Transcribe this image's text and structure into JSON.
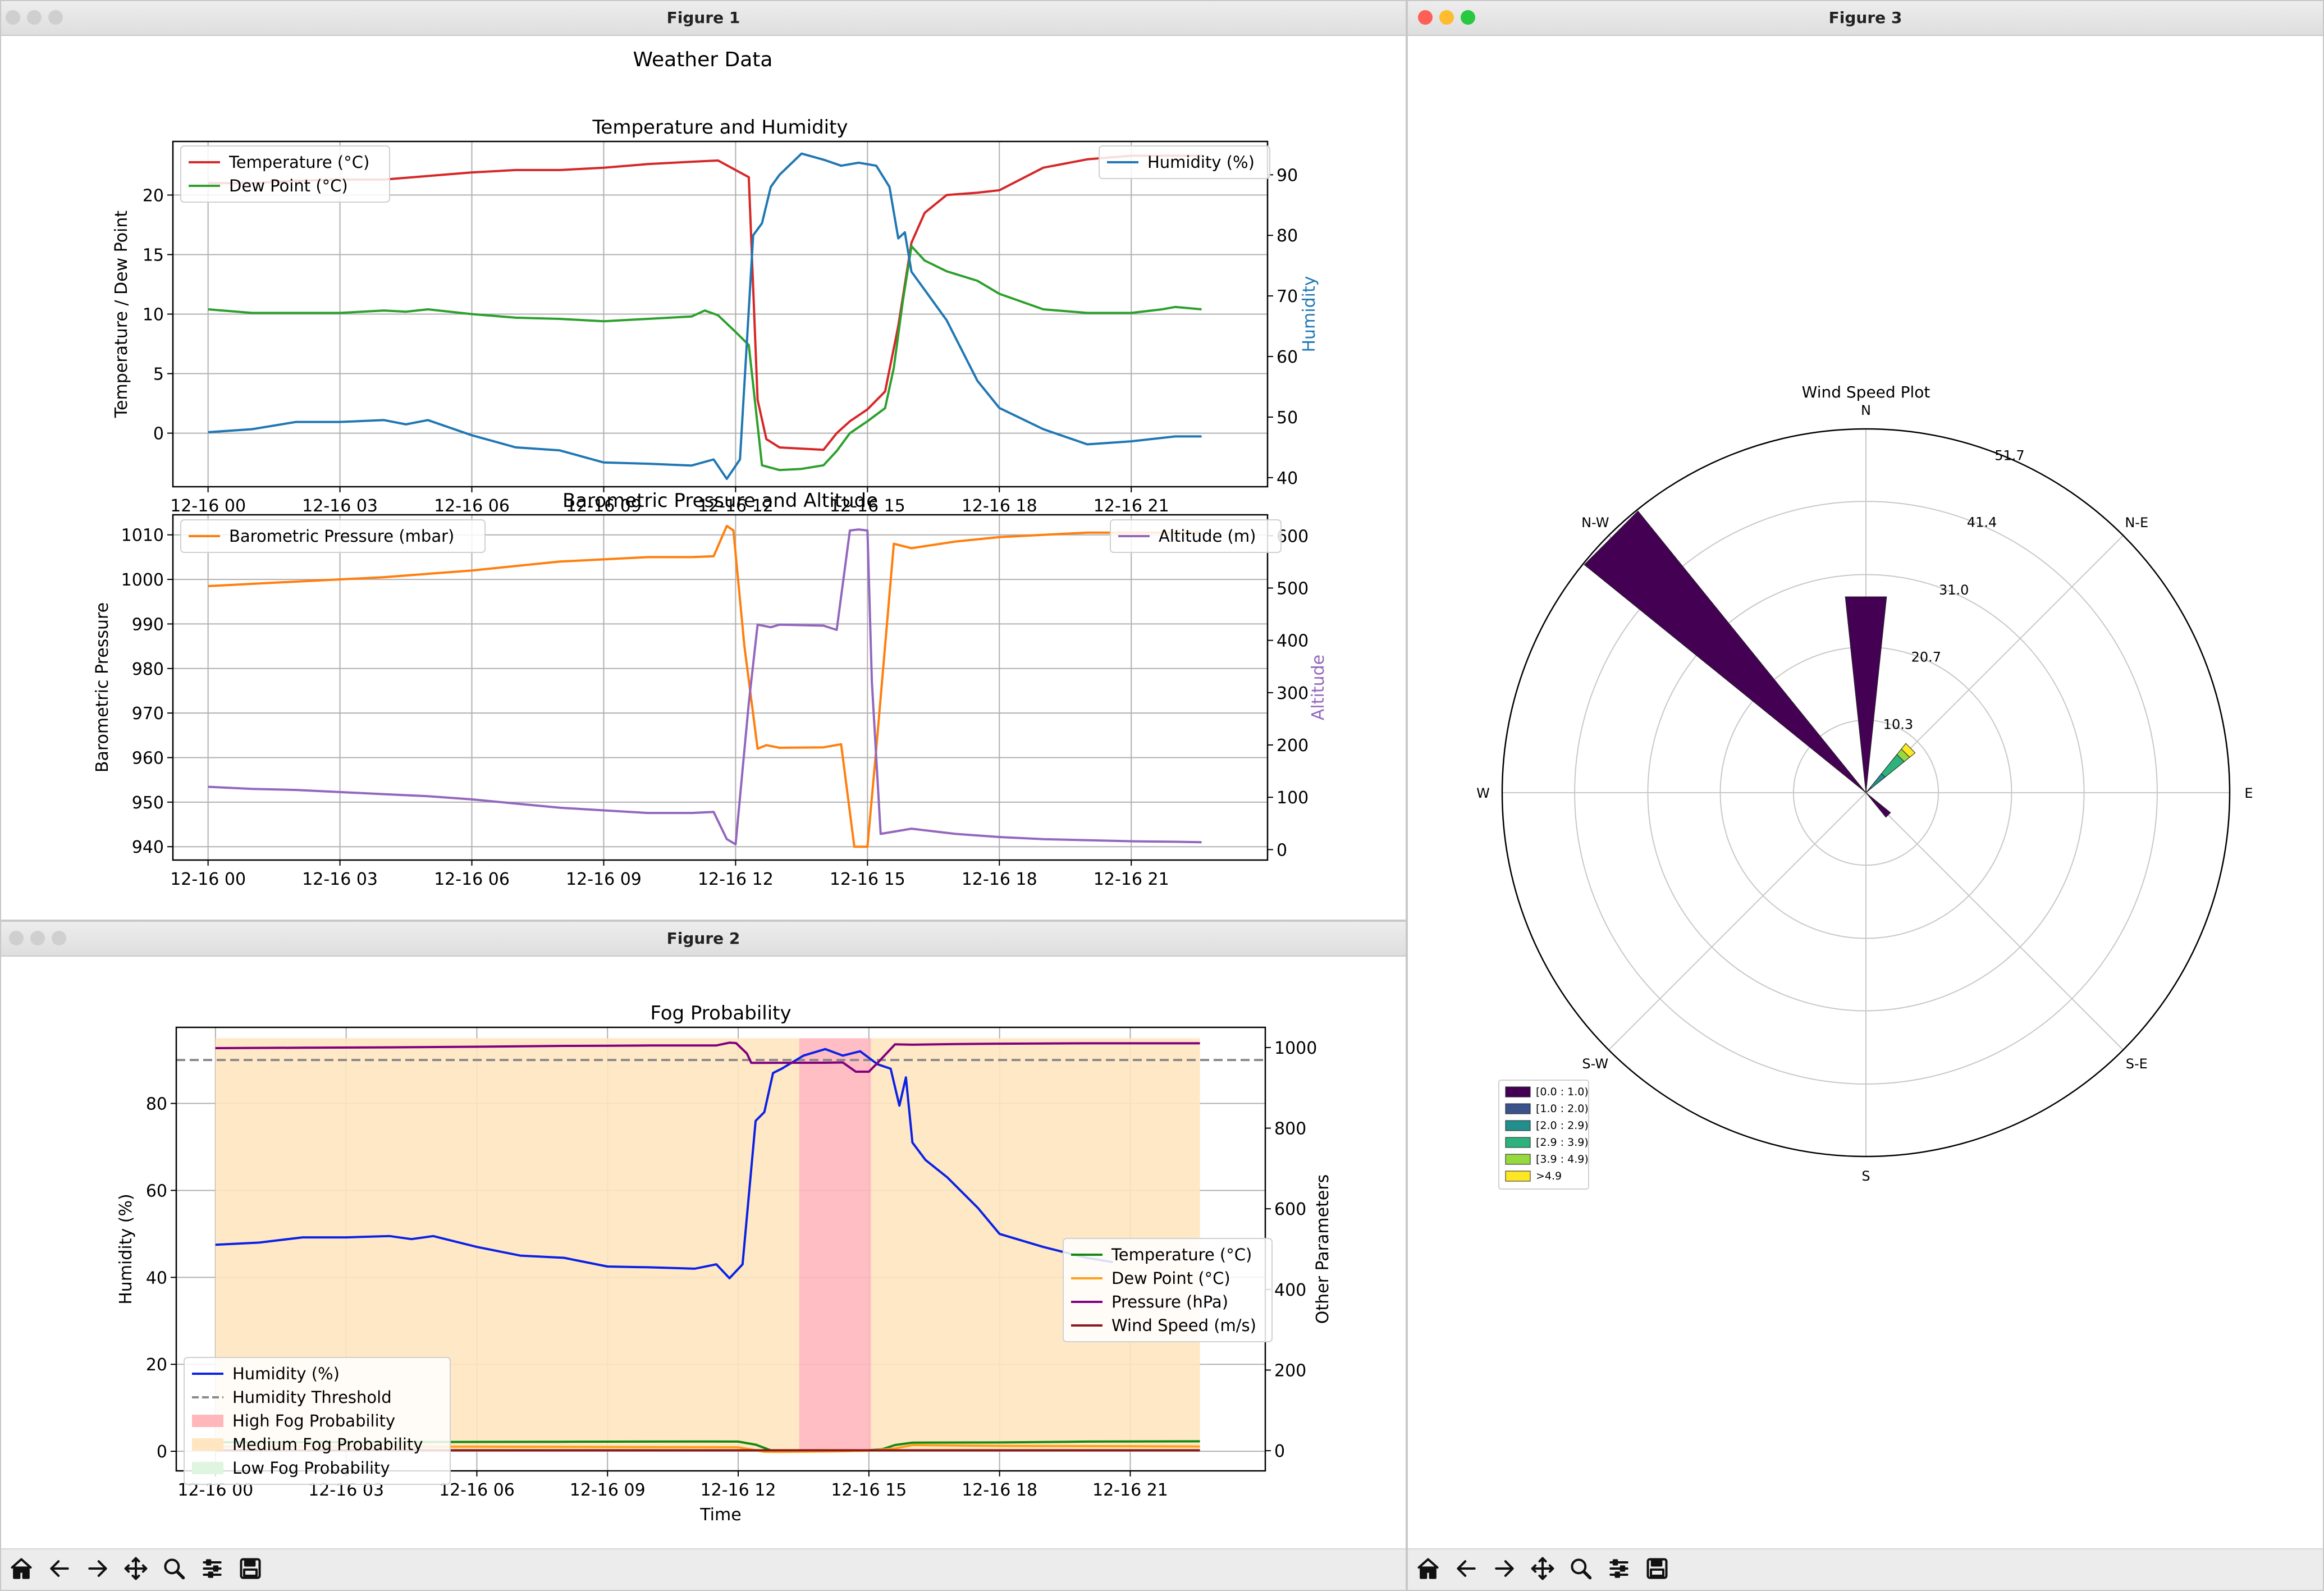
{
  "colors": {
    "temp": "#d62728",
    "dew": "#2ca02c",
    "hum": "#1f77b4",
    "baro": "#ff7f0e",
    "alt": "#9467bd",
    "fog_hum": "#0a22e6",
    "fog_temp": "#128a12",
    "fog_dew": "#ff9f1a",
    "fog_press": "#800080",
    "fog_wind": "#8b1a1a",
    "high": "#ffb7bc",
    "medium": "#ffe5c0",
    "low": "#dff5df",
    "threshold": "#8a8a8a"
  },
  "icons": [
    "home-icon",
    "back-arrow-icon",
    "forward-arrow-icon",
    "pan-icon",
    "zoom-icon",
    "configure-icon",
    "save-icon"
  ],
  "windows": {
    "fig1": {
      "title": "Figure 1"
    },
    "fig2": {
      "title": "Figure 2"
    },
    "fig3": {
      "title": "Figure 3"
    }
  },
  "fig1": {
    "suptitle": "Weather Data"
  },
  "chart_data": [
    {
      "type": "line",
      "title": "Temperature and Humidity",
      "xlabel": "",
      "ylabel": "Temperature / Dew Point",
      "y2label": "Humidity",
      "ylim": [
        -4.5,
        24.5
      ],
      "y2lim": [
        38.5,
        95.5
      ],
      "xlim": [
        -0.8,
        24.1
      ],
      "xticks": [
        0,
        3,
        6,
        9,
        12,
        15,
        18,
        21
      ],
      "xtick_labels": [
        "12-16 00",
        "12-16 03",
        "12-16 06",
        "12-16 09",
        "12-16 12",
        "12-16 15",
        "12-16 18",
        "12-16 21"
      ],
      "yticks": [
        0,
        5,
        10,
        15,
        20
      ],
      "y2ticks": [
        40,
        50,
        60,
        70,
        80,
        90
      ],
      "grid": true,
      "legend": {
        "left": [
          "Temperature (°C)",
          "Dew Point (°C)"
        ],
        "right": [
          "Humidity (%)"
        ]
      },
      "series": [
        {
          "name": "Temperature (°C)",
          "axis": "left",
          "x": [
            0,
            1,
            2,
            3,
            4,
            5,
            6,
            7,
            8,
            9,
            10,
            11,
            11.6,
            11.95,
            12.3,
            12.5,
            12.7,
            13,
            13.5,
            14,
            14.3,
            14.6,
            15,
            15.4,
            15.7,
            16,
            16.3,
            16.8,
            17.5,
            18,
            19,
            20,
            21,
            22,
            22.6
          ],
          "y": [
            21,
            21,
            21.2,
            21.3,
            21.3,
            21.6,
            21.9,
            22.1,
            22.1,
            22.3,
            22.6,
            22.8,
            22.9,
            22.2,
            21.5,
            2.8,
            -0.5,
            -1.2,
            -1.3,
            -1.4,
            0,
            1,
            2,
            3.5,
            9,
            16,
            18.5,
            20,
            20.2,
            20.4,
            22.3,
            23,
            23.3,
            23.3,
            23.3
          ]
        },
        {
          "name": "Dew Point (°C)",
          "axis": "left",
          "x": [
            0,
            1,
            2,
            3,
            4,
            4.5,
            5,
            6,
            7,
            8,
            9,
            10,
            11,
            11.3,
            11.6,
            12,
            12.3,
            12.6,
            13,
            13.5,
            14,
            14.3,
            14.6,
            15,
            15.4,
            15.6,
            15.8,
            16,
            16.3,
            16.8,
            17.5,
            18,
            19,
            20,
            21,
            21.7,
            22,
            22.6
          ],
          "y": [
            10.4,
            10.1,
            10.1,
            10.1,
            10.3,
            10.2,
            10.4,
            10.0,
            9.7,
            9.6,
            9.4,
            9.6,
            9.8,
            10.3,
            9.9,
            8.5,
            7.4,
            -2.7,
            -3.1,
            -3.0,
            -2.7,
            -1.5,
            0,
            1.0,
            2.1,
            5.5,
            11,
            15.7,
            14.5,
            13.6,
            12.8,
            11.7,
            10.4,
            10.1,
            10.1,
            10.4,
            10.6,
            10.4
          ]
        },
        {
          "name": "Humidity (%)",
          "axis": "right",
          "x": [
            0,
            1,
            2,
            3,
            4,
            4.5,
            5,
            6,
            7,
            8,
            9,
            10,
            11,
            11.5,
            11.8,
            12.1,
            12.4,
            12.6,
            12.8,
            13,
            13.5,
            14,
            14.4,
            14.8,
            15.2,
            15.5,
            15.7,
            15.85,
            16,
            16.3,
            16.8,
            17.5,
            18,
            19,
            20,
            21,
            22,
            22.6
          ],
          "y": [
            47.5,
            48,
            49.2,
            49.2,
            49.5,
            48.8,
            49.5,
            47,
            45,
            44.5,
            42.5,
            42.3,
            42,
            43,
            39.8,
            43,
            80,
            82,
            88,
            90,
            93.5,
            92.5,
            91.5,
            92,
            91.5,
            88,
            79.5,
            80.5,
            74,
            71,
            66,
            56,
            51.5,
            48,
            45.5,
            46,
            46.8,
            46.8
          ]
        }
      ]
    },
    {
      "type": "line",
      "title": "Barometric Pressure and Altitude",
      "xlabel": "",
      "ylabel": "Barometric Pressure",
      "y2label": "Altitude",
      "ylim": [
        937,
        1014.5
      ],
      "y2lim": [
        -20,
        640
      ],
      "xlim": [
        -0.8,
        24.1
      ],
      "xticks": [
        0,
        3,
        6,
        9,
        12,
        15,
        18,
        21
      ],
      "xtick_labels": [
        "12-16 00",
        "12-16 03",
        "12-16 06",
        "12-16 09",
        "12-16 12",
        "12-16 15",
        "12-16 18",
        "12-16 21"
      ],
      "yticks": [
        940,
        950,
        960,
        970,
        980,
        990,
        1000,
        1010
      ],
      "y2ticks": [
        0,
        100,
        200,
        300,
        400,
        500,
        600
      ],
      "grid": true,
      "legend": {
        "left": [
          "Barometric Pressure (mbar)"
        ],
        "right": [
          "Altitude (m)"
        ]
      },
      "series": [
        {
          "name": "Barometric Pressure (mbar)",
          "axis": "left",
          "x": [
            0,
            2,
            4,
            6,
            8,
            9,
            10,
            11,
            11.5,
            11.8,
            11.95,
            12.2,
            12.5,
            12.7,
            13,
            14,
            14.4,
            14.7,
            15,
            15.2,
            15.6,
            16,
            17,
            18,
            20,
            22,
            22.6
          ],
          "y": [
            998.5,
            999.5,
            1000.5,
            1002,
            1004,
            1004.5,
            1005,
            1005,
            1005.2,
            1012,
            1011,
            985,
            962,
            962.8,
            962.2,
            962.3,
            963,
            940,
            940,
            962,
            1008,
            1007,
            1008.5,
            1009.5,
            1010.5,
            1010.5,
            1010.5
          ]
        },
        {
          "name": "Altitude (m)",
          "axis": "right",
          "x": [
            0,
            1,
            2,
            3,
            4,
            5,
            6,
            7,
            8,
            9,
            10,
            11,
            11.5,
            11.8,
            12,
            12.3,
            12.5,
            12.8,
            13,
            14,
            14.3,
            14.6,
            14.8,
            15,
            15.1,
            15.3,
            16,
            17,
            18,
            19,
            20,
            21,
            22,
            22.6
          ],
          "y": [
            120,
            116,
            114,
            110,
            106,
            102,
            96,
            88,
            80,
            75,
            70,
            70,
            72,
            20,
            10,
            280,
            430,
            425,
            430,
            428,
            420,
            610,
            612,
            610,
            320,
            30,
            40,
            30,
            24,
            20,
            18,
            16,
            15,
            14
          ]
        }
      ]
    },
    {
      "type": "area",
      "title": "Fog Probability",
      "xlabel": "Time",
      "ylabel": "Humidity (%)",
      "y2label": "Other Parameters",
      "ylim": [
        -4.5,
        97.5
      ],
      "y2lim": [
        -50,
        1050
      ],
      "xlim": [
        -0.9,
        24.1
      ],
      "xticks": [
        0,
        3,
        6,
        9,
        12,
        15,
        18,
        21
      ],
      "xtick_labels": [
        "12-16 00",
        "12-16 03",
        "12-16 06",
        "12-16 09",
        "12-16 12",
        "12-16 15",
        "12-16 18",
        "12-16 21"
      ],
      "yticks": [
        0,
        20,
        40,
        60,
        80
      ],
      "y2ticks": [
        0,
        200,
        400,
        600,
        800,
        1000
      ],
      "grid": true,
      "threshold": 90,
      "legend": {
        "left": [
          "Humidity (%)",
          "Humidity Threshold",
          "High Fog Probability",
          "Medium Fog Probability",
          "Low Fog Probability"
        ],
        "right": [
          "Temperature (°C)",
          "Dew Point (°C)",
          "Pressure (hPa)",
          "Wind Speed (m/s)"
        ]
      },
      "bands": [
        {
          "name": "High Fog Probability",
          "x_start": 13.4,
          "x_end": 15.05
        },
        {
          "name": "Medium Fog Probability",
          "x_start": 0,
          "x_end": 13.4
        },
        {
          "name": "Medium Fog Probability",
          "x_start": 15.05,
          "x_end": 22.6
        }
      ],
      "series": [
        {
          "name": "Humidity (%)",
          "axis": "left",
          "x": [
            0,
            1,
            2,
            3,
            4,
            4.5,
            5,
            6,
            7,
            8,
            9,
            10,
            11,
            11.5,
            11.8,
            12.1,
            12.4,
            12.6,
            12.8,
            13,
            13.5,
            14,
            14.4,
            14.8,
            15.2,
            15.5,
            15.7,
            15.85,
            16,
            16.3,
            16.8,
            17.5,
            18,
            19,
            20,
            20.6
          ],
          "y": [
            47.5,
            48,
            49.2,
            49.2,
            49.5,
            48.8,
            49.5,
            47,
            45,
            44.5,
            42.5,
            42.3,
            42,
            43,
            39.8,
            43,
            76,
            78,
            87,
            88,
            91,
            92.5,
            91,
            92,
            89,
            88,
            79.5,
            86,
            71,
            67,
            63,
            56,
            50,
            47,
            44.5,
            43.5
          ]
        },
        {
          "name": "Temperature (°C)",
          "axis": "right",
          "x": [
            0,
            4,
            8,
            11,
            12,
            12.4,
            12.8,
            13.5,
            14.5,
            15,
            15.3,
            15.6,
            16,
            18,
            20,
            22.6
          ],
          "y": [
            21,
            21.3,
            22.1,
            22.8,
            22.5,
            15,
            -1.2,
            -1.3,
            -1,
            1,
            3.5,
            14,
            20,
            20.5,
            22.5,
            23.3
          ]
        },
        {
          "name": "Dew Point (°C)",
          "axis": "right",
          "x": [
            0,
            6,
            12,
            12.6,
            13,
            14.3,
            15,
            15.6,
            16,
            18,
            22.6
          ],
          "y": [
            10.4,
            10,
            8.5,
            -2.7,
            -3,
            -1.5,
            0,
            5.5,
            14,
            12,
            10.4
          ]
        },
        {
          "name": "Pressure (hPa)",
          "axis": "right",
          "x": [
            0,
            2,
            4,
            6,
            8,
            9,
            10,
            11,
            11.5,
            11.8,
            11.95,
            12.2,
            12.3,
            13,
            14,
            14.4,
            14.7,
            15,
            15.2,
            15.6,
            16,
            17,
            18,
            20,
            22,
            22.6
          ],
          "y": [
            998.5,
            999.5,
            1000.5,
            1002,
            1004,
            1004.5,
            1005,
            1005,
            1005.2,
            1012,
            1011,
            985,
            962,
            962.2,
            962.3,
            963,
            940,
            940,
            962,
            1008,
            1007,
            1008.5,
            1009.5,
            1010.5,
            1010.5,
            1010.5
          ]
        },
        {
          "name": "Wind Speed (m/s)",
          "axis": "right",
          "x": [
            0,
            22.6
          ],
          "y": [
            1,
            1
          ]
        }
      ]
    },
    {
      "type": "bar",
      "subtype": "polar-windrose",
      "title": "Wind Speed Plot",
      "directions": [
        "N",
        "N-E",
        "E",
        "S-E",
        "S",
        "S-W",
        "W",
        "N-W"
      ],
      "radial_ticks": [
        10.3,
        20.7,
        31.0,
        41.4,
        51.7
      ],
      "rmax": 51.7,
      "legend": [
        "[0.0 : 1.0)",
        "[1.0 : 2.0)",
        "[2.0 : 2.9)",
        "[2.9 : 3.9)",
        "[3.9 : 4.9)",
        ">4.9"
      ],
      "bin_colors": [
        "#440154",
        "#3b528b",
        "#21908d",
        "#2db27d",
        "#95d840",
        "#fde725"
      ],
      "series": [
        {
          "direction": "N",
          "values": [
            28,
            0,
            0,
            0,
            0,
            0
          ]
        },
        {
          "direction": "N-E",
          "values": [
            0.5,
            0.5,
            2.5,
            3.5,
            1,
            1
          ]
        },
        {
          "direction": "E",
          "values": [
            0,
            0,
            0,
            0,
            0,
            0
          ]
        },
        {
          "direction": "S-E",
          "values": [
            4.5,
            0,
            0,
            0,
            0,
            0
          ]
        },
        {
          "direction": "S",
          "values": [
            0,
            0,
            0,
            0,
            0,
            0
          ]
        },
        {
          "direction": "S-W",
          "values": [
            0,
            0,
            0,
            0,
            0,
            0
          ]
        },
        {
          "direction": "W",
          "values": [
            0,
            0,
            0,
            0,
            0,
            0
          ]
        },
        {
          "direction": "N-W",
          "values": [
            51.5,
            0,
            0,
            0,
            0,
            0
          ]
        }
      ]
    }
  ]
}
